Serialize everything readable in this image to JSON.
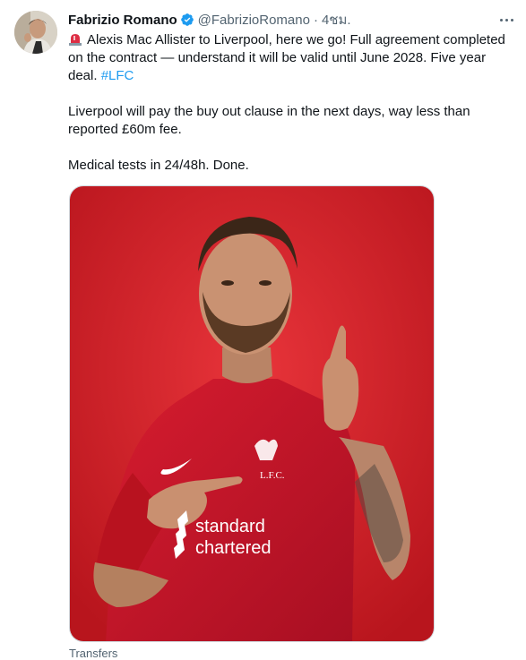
{
  "author": {
    "name": "Fabrizio Romano",
    "handle": "@FabrizioRomano",
    "separator": "·",
    "time": "4ชม.",
    "verified": true
  },
  "icons": {
    "verified": "verified-badge-icon",
    "emoji": "police-siren-icon",
    "more": "more-options-icon"
  },
  "tweet": {
    "line1_text": "Alexis Mac Allister to Liverpool, here we go! Full agreement completed on the contract — understand it will be valid until June 2028. Five year deal.",
    "hashtag": "#LFC",
    "paragraph2": "Liverpool will pay the buy out clause in the next days, way less than reported £60m fee.",
    "paragraph3": "Medical tests in 24/48h. Done."
  },
  "media": {
    "crest_text": "L.F.C.",
    "sponsor_line1": "standard",
    "sponsor_line2": "chartered"
  },
  "footer": {
    "label": "Transfers"
  },
  "colors": {
    "link": "#1d9bf0",
    "background_red": "#d2232a",
    "shirt_red": "#c8102e",
    "secondary_text": "#536471"
  }
}
